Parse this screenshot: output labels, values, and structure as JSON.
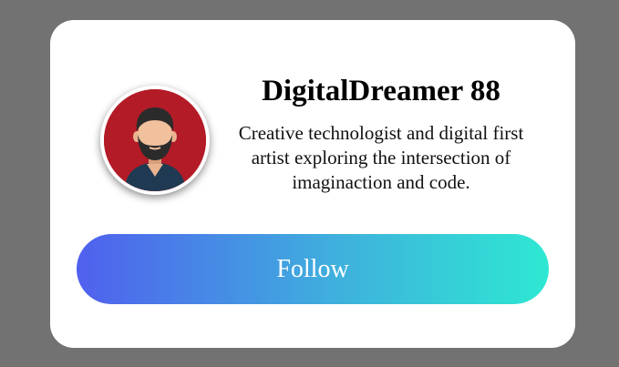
{
  "profile": {
    "name": "DigitalDreamer 88",
    "bio": "Creative technologist and digital first artist exploring the intersection of imaginaction and code.",
    "avatar_icon": "person-avatar-icon"
  },
  "actions": {
    "follow_label": "Follow"
  },
  "colors": {
    "background": "#737272",
    "card": "#ffffff",
    "avatar_bg": "#b31b27",
    "button_gradient_start": "#5060ee",
    "button_gradient_end": "#2ee8d2"
  }
}
